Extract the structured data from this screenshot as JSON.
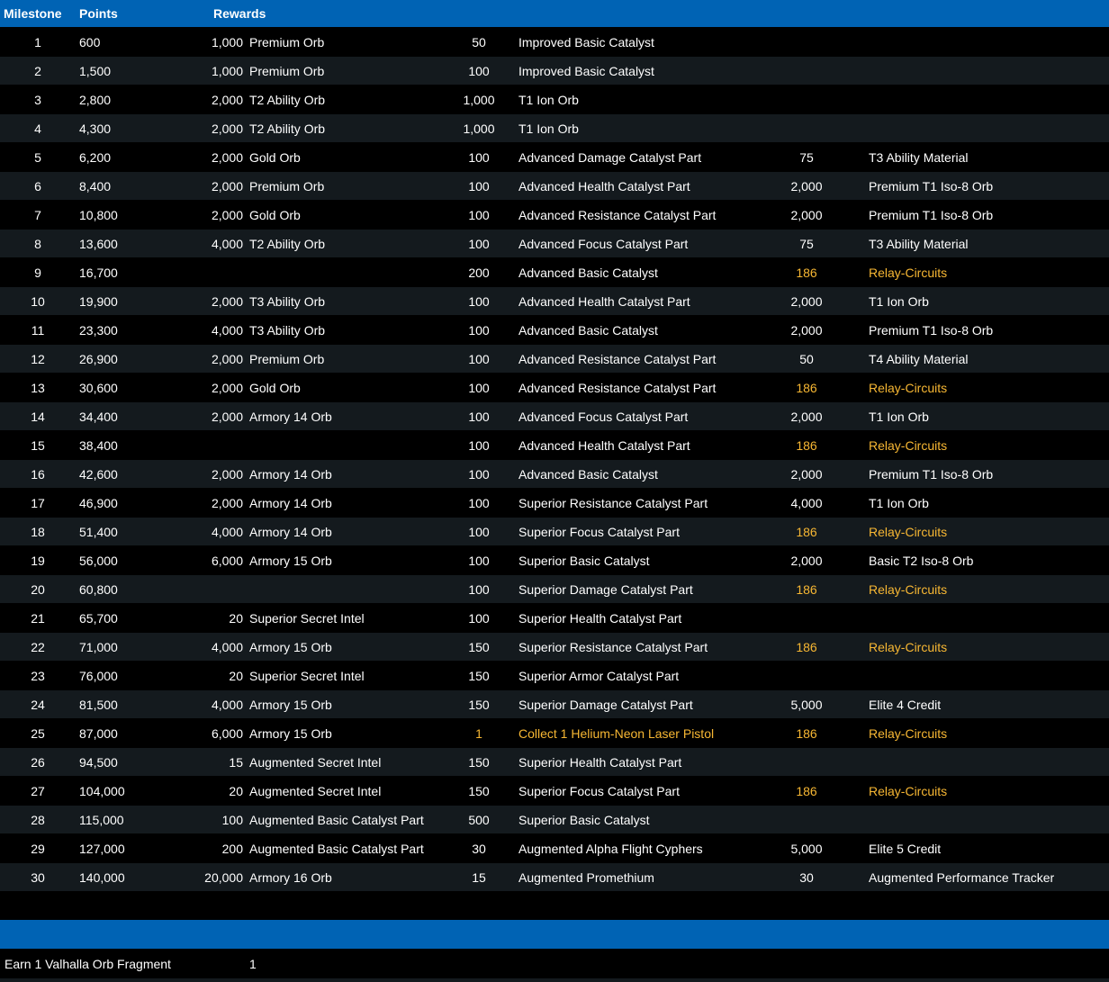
{
  "header": {
    "milestone_label": "Milestone",
    "points_label": "Points",
    "rewards_label": "Rewards"
  },
  "colors": {
    "header_bg": "#0063b4",
    "row_alt_bg": "#141a1e",
    "highlight_text": "#f7b733"
  },
  "rows": [
    {
      "milestone": "1",
      "points": "600",
      "r1_qty": "1,000",
      "r1_name": "Premium Orb",
      "r2_qty": "50",
      "r2_name": "Improved Basic Catalyst",
      "r3_qty": "",
      "r3_name": "",
      "hl2": false,
      "hl3": false
    },
    {
      "milestone": "2",
      "points": "1,500",
      "r1_qty": "1,000",
      "r1_name": "Premium Orb",
      "r2_qty": "100",
      "r2_name": "Improved Basic Catalyst",
      "r3_qty": "",
      "r3_name": "",
      "hl2": false,
      "hl3": false
    },
    {
      "milestone": "3",
      "points": "2,800",
      "r1_qty": "2,000",
      "r1_name": "T2 Ability Orb",
      "r2_qty": "1,000",
      "r2_name": "T1 Ion Orb",
      "r3_qty": "",
      "r3_name": "",
      "hl2": false,
      "hl3": false
    },
    {
      "milestone": "4",
      "points": "4,300",
      "r1_qty": "2,000",
      "r1_name": "T2 Ability Orb",
      "r2_qty": "1,000",
      "r2_name": "T1 Ion Orb",
      "r3_qty": "",
      "r3_name": "",
      "hl2": false,
      "hl3": false
    },
    {
      "milestone": "5",
      "points": "6,200",
      "r1_qty": "2,000",
      "r1_name": "Gold Orb",
      "r2_qty": "100",
      "r2_name": "Advanced Damage Catalyst Part",
      "r3_qty": "75",
      "r3_name": "T3 Ability Material",
      "hl2": false,
      "hl3": false
    },
    {
      "milestone": "6",
      "points": "8,400",
      "r1_qty": "2,000",
      "r1_name": "Premium Orb",
      "r2_qty": "100",
      "r2_name": "Advanced Health Catalyst Part",
      "r3_qty": "2,000",
      "r3_name": "Premium T1 Iso-8 Orb",
      "hl2": false,
      "hl3": false
    },
    {
      "milestone": "7",
      "points": "10,800",
      "r1_qty": "2,000",
      "r1_name": "Gold Orb",
      "r2_qty": "100",
      "r2_name": "Advanced Resistance Catalyst Part",
      "r3_qty": "2,000",
      "r3_name": "Premium T1 Iso-8 Orb",
      "hl2": false,
      "hl3": false
    },
    {
      "milestone": "8",
      "points": "13,600",
      "r1_qty": "4,000",
      "r1_name": "T2 Ability Orb",
      "r2_qty": "100",
      "r2_name": "Advanced Focus Catalyst Part",
      "r3_qty": "75",
      "r3_name": "T3 Ability Material",
      "hl2": false,
      "hl3": false
    },
    {
      "milestone": "9",
      "points": "16,700",
      "r1_qty": "",
      "r1_name": "",
      "r2_qty": "200",
      "r2_name": "Advanced Basic Catalyst",
      "r3_qty": "186",
      "r3_name": "Relay-Circuits",
      "hl2": false,
      "hl3": true
    },
    {
      "milestone": "10",
      "points": "19,900",
      "r1_qty": "2,000",
      "r1_name": "T3 Ability Orb",
      "r2_qty": "100",
      "r2_name": "Advanced Health Catalyst Part",
      "r3_qty": "2,000",
      "r3_name": "T1 Ion Orb",
      "hl2": false,
      "hl3": false
    },
    {
      "milestone": "11",
      "points": "23,300",
      "r1_qty": "4,000",
      "r1_name": "T3 Ability Orb",
      "r2_qty": "100",
      "r2_name": "Advanced Basic Catalyst",
      "r3_qty": "2,000",
      "r3_name": "Premium T1 Iso-8 Orb",
      "hl2": false,
      "hl3": false
    },
    {
      "milestone": "12",
      "points": "26,900",
      "r1_qty": "2,000",
      "r1_name": "Premium Orb",
      "r2_qty": "100",
      "r2_name": "Advanced Resistance Catalyst Part",
      "r3_qty": "50",
      "r3_name": "T4 Ability Material",
      "hl2": false,
      "hl3": false
    },
    {
      "milestone": "13",
      "points": "30,600",
      "r1_qty": "2,000",
      "r1_name": "Gold Orb",
      "r2_qty": "100",
      "r2_name": "Advanced Resistance Catalyst Part",
      "r3_qty": "186",
      "r3_name": "Relay-Circuits",
      "hl2": false,
      "hl3": true
    },
    {
      "milestone": "14",
      "points": "34,400",
      "r1_qty": "2,000",
      "r1_name": "Armory 14 Orb",
      "r2_qty": "100",
      "r2_name": "Advanced Focus Catalyst Part",
      "r3_qty": "2,000",
      "r3_name": "T1 Ion Orb",
      "hl2": false,
      "hl3": false
    },
    {
      "milestone": "15",
      "points": "38,400",
      "r1_qty": "",
      "r1_name": "",
      "r2_qty": "100",
      "r2_name": "Advanced Health Catalyst Part",
      "r3_qty": "186",
      "r3_name": "Relay-Circuits",
      "hl2": false,
      "hl3": true
    },
    {
      "milestone": "16",
      "points": "42,600",
      "r1_qty": "2,000",
      "r1_name": "Armory 14 Orb",
      "r2_qty": "100",
      "r2_name": "Advanced Basic Catalyst",
      "r3_qty": "2,000",
      "r3_name": "Premium T1 Iso-8 Orb",
      "hl2": false,
      "hl3": false
    },
    {
      "milestone": "17",
      "points": "46,900",
      "r1_qty": "2,000",
      "r1_name": "Armory 14 Orb",
      "r2_qty": "100",
      "r2_name": "Superior Resistance Catalyst Part",
      "r3_qty": "4,000",
      "r3_name": "T1 Ion Orb",
      "hl2": false,
      "hl3": false
    },
    {
      "milestone": "18",
      "points": "51,400",
      "r1_qty": "4,000",
      "r1_name": "Armory 14 Orb",
      "r2_qty": "100",
      "r2_name": "Superior Focus Catalyst Part",
      "r3_qty": "186",
      "r3_name": "Relay-Circuits",
      "hl2": false,
      "hl3": true
    },
    {
      "milestone": "19",
      "points": "56,000",
      "r1_qty": "6,000",
      "r1_name": "Armory 15 Orb",
      "r2_qty": "100",
      "r2_name": "Superior Basic Catalyst",
      "r3_qty": "2,000",
      "r3_name": "Basic T2 Iso-8 Orb",
      "hl2": false,
      "hl3": false
    },
    {
      "milestone": "20",
      "points": "60,800",
      "r1_qty": "",
      "r1_name": "",
      "r2_qty": "100",
      "r2_name": "Superior Damage Catalyst Part",
      "r3_qty": "186",
      "r3_name": "Relay-Circuits",
      "hl2": false,
      "hl3": true
    },
    {
      "milestone": "21",
      "points": "65,700",
      "r1_qty": "20",
      "r1_name": "Superior Secret Intel",
      "r2_qty": "100",
      "r2_name": "Superior Health Catalyst Part",
      "r3_qty": "",
      "r3_name": "",
      "hl2": false,
      "hl3": false
    },
    {
      "milestone": "22",
      "points": "71,000",
      "r1_qty": "4,000",
      "r1_name": "Armory 15 Orb",
      "r2_qty": "150",
      "r2_name": "Superior Resistance Catalyst Part",
      "r3_qty": "186",
      "r3_name": "Relay-Circuits",
      "hl2": false,
      "hl3": true
    },
    {
      "milestone": "23",
      "points": "76,000",
      "r1_qty": "20",
      "r1_name": "Superior Secret Intel",
      "r2_qty": "150",
      "r2_name": "Superior Armor Catalyst Part",
      "r3_qty": "",
      "r3_name": "",
      "hl2": false,
      "hl3": false
    },
    {
      "milestone": "24",
      "points": "81,500",
      "r1_qty": "4,000",
      "r1_name": "Armory 15 Orb",
      "r2_qty": "150",
      "r2_name": "Superior Damage Catalyst Part",
      "r3_qty": "5,000",
      "r3_name": "Elite 4 Credit",
      "hl2": false,
      "hl3": false
    },
    {
      "milestone": "25",
      "points": "87,000",
      "r1_qty": "6,000",
      "r1_name": "Armory 15 Orb",
      "r2_qty": "1",
      "r2_name": "Collect 1 Helium-Neon Laser Pistol",
      "r3_qty": "186",
      "r3_name": "Relay-Circuits",
      "hl2": true,
      "hl3": true
    },
    {
      "milestone": "26",
      "points": "94,500",
      "r1_qty": "15",
      "r1_name": "Augmented Secret Intel",
      "r2_qty": "150",
      "r2_name": "Superior Health Catalyst Part",
      "r3_qty": "",
      "r3_name": "",
      "hl2": false,
      "hl3": false
    },
    {
      "milestone": "27",
      "points": "104,000",
      "r1_qty": "20",
      "r1_name": "Augmented Secret Intel",
      "r2_qty": "150",
      "r2_name": "Superior Focus Catalyst Part",
      "r3_qty": "186",
      "r3_name": "Relay-Circuits",
      "hl2": false,
      "hl3": true
    },
    {
      "milestone": "28",
      "points": "115,000",
      "r1_qty": "100",
      "r1_name": "Augmented Basic Catalyst Part",
      "r2_qty": "500",
      "r2_name": "Superior Basic Catalyst",
      "r3_qty": "",
      "r3_name": "",
      "hl2": false,
      "hl3": false
    },
    {
      "milestone": "29",
      "points": "127,000",
      "r1_qty": "200",
      "r1_name": "Augmented Basic Catalyst Part",
      "r2_qty": "30",
      "r2_name": "Augmented Alpha Flight Cyphers",
      "r3_qty": "5,000",
      "r3_name": "Elite 5 Credit",
      "hl2": false,
      "hl3": false
    },
    {
      "milestone": "30",
      "points": "140,000",
      "r1_qty": "20,000",
      "r1_name": "Armory 16 Orb",
      "r2_qty": "15",
      "r2_name": "Augmented Promethium",
      "r3_qty": "30",
      "r3_name": "Augmented Performance Tracker",
      "hl2": false,
      "hl3": false
    }
  ],
  "footer": {
    "label": "Earn 1 Valhalla Orb Fragment",
    "qty": "1"
  }
}
